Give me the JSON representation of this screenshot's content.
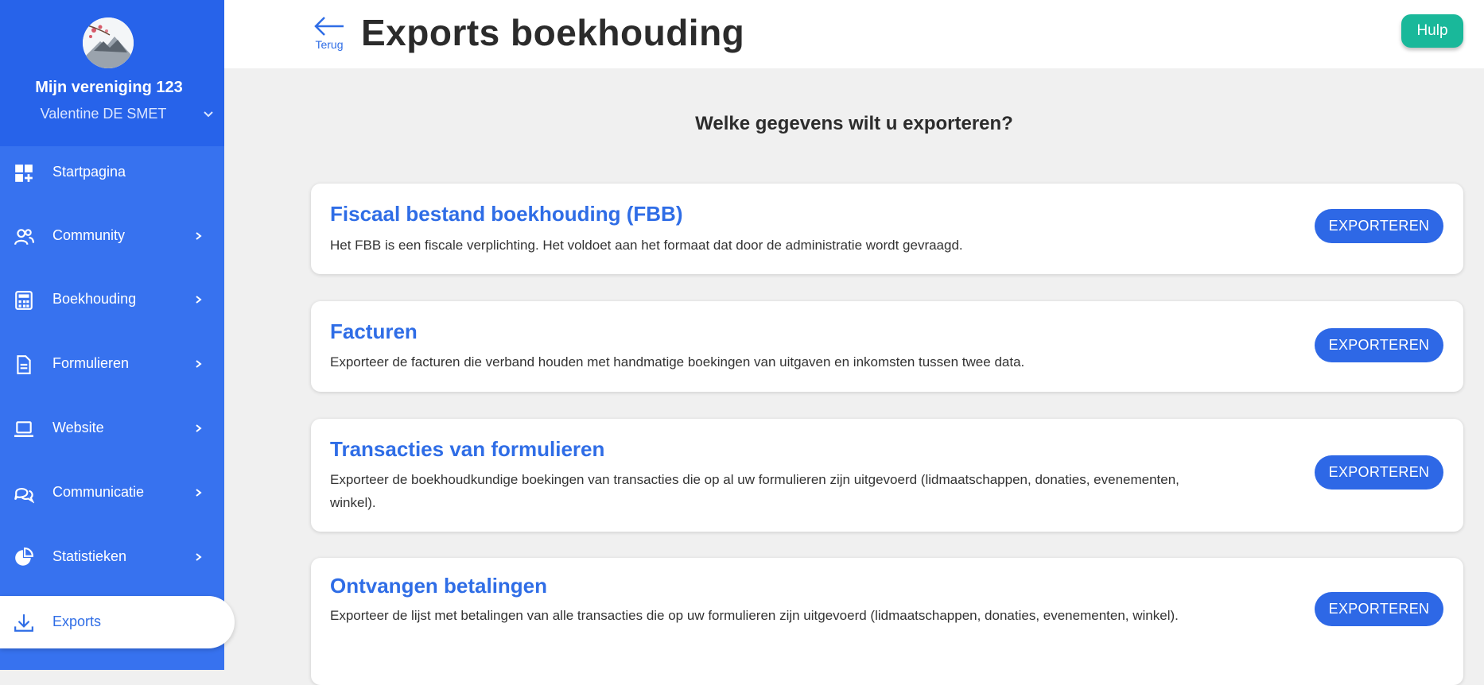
{
  "sidebar": {
    "org_name": "Mijn vereniging 123",
    "user_name": "Valentine DE SMET",
    "items": [
      {
        "label": "Startpagina",
        "icon": "dashboard-icon",
        "has_chevron": false
      },
      {
        "label": "Community",
        "icon": "users-icon",
        "has_chevron": true
      },
      {
        "label": "Boekhouding",
        "icon": "calculator-icon",
        "has_chevron": true
      },
      {
        "label": "Formulieren",
        "icon": "document-icon",
        "has_chevron": true
      },
      {
        "label": "Website",
        "icon": "laptop-icon",
        "has_chevron": true
      },
      {
        "label": "Communicatie",
        "icon": "chat-icon",
        "has_chevron": true
      },
      {
        "label": "Statistieken",
        "icon": "pie-chart-icon",
        "has_chevron": true
      },
      {
        "label": "Exports",
        "icon": "download-icon",
        "has_chevron": false,
        "active": true
      }
    ]
  },
  "header": {
    "back_label": "Terug",
    "title": "Exports boekhouding",
    "help_label": "Hulp"
  },
  "main": {
    "question": "Welke gegevens wilt u exporteren?",
    "cards": [
      {
        "title": "Fiscaal bestand boekhouding (FBB)",
        "description": "Het FBB is een fiscale verplichting. Het voldoet aan het formaat dat door de administratie wordt gevraagd.",
        "button": "EXPORTEREN"
      },
      {
        "title": "Facturen",
        "description": "Exporteer de facturen die verband houden met handmatige boekingen van uitgaven en inkomsten tussen twee data.",
        "button": "EXPORTEREN"
      },
      {
        "title": "Transacties van formulieren",
        "description": "Exporteer de boekhoudkundige boekingen van transacties die op al uw formulieren zijn uitgevoerd (lidmaatschappen, donaties, evenementen, winkel).",
        "button": "EXPORTEREN"
      },
      {
        "title": "Ontvangen betalingen",
        "description": "Exporteer de lijst met betalingen van alle transacties die op uw formulieren zijn uitgevoerd (lidmaatschappen, donaties, evenementen, winkel).",
        "button": "EXPORTEREN"
      }
    ]
  },
  "colors": {
    "sidebar": "#3772ef",
    "sidebar_header": "#2763ea",
    "accent": "#2f6de6",
    "help": "#19b89a",
    "background": "#f0f0f0"
  }
}
